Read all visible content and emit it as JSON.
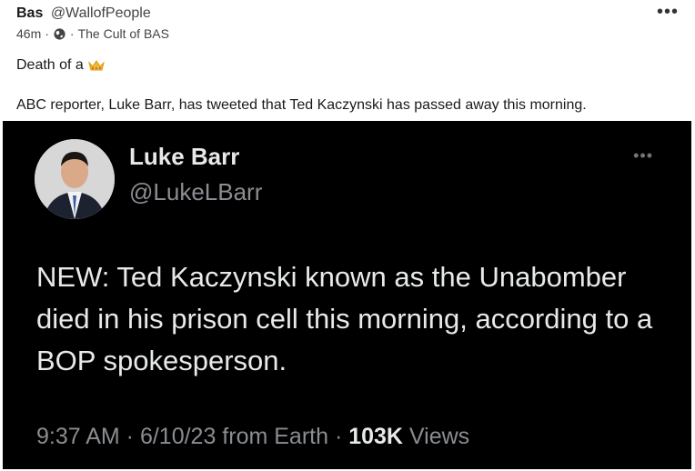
{
  "post": {
    "author": "Bas",
    "handle": "@WallofPeople",
    "time": "46m",
    "dot": "·",
    "community": "The Cult of BAS",
    "more": "•••",
    "line1": "Death of a",
    "line1_emoji": "crown-icon",
    "line2": "ABC reporter, Luke Barr, has tweeted that Ted Kaczynski has passed away this morning."
  },
  "tweet": {
    "name": "Luke Barr",
    "handle": "@LukeLBarr",
    "more": "•••",
    "text": "NEW: Ted Kaczynski known as the Unabomber died in his prison cell this morning, according to a BOP spokesperson.",
    "footer_prefix": "9:37 AM · 6/10/23 from Earth · ",
    "views_count": "103K",
    "views_label": " Views"
  },
  "colors": {
    "tweet_bg": "#000000",
    "muted": "#8a8d91",
    "crown": "#f5b928"
  }
}
